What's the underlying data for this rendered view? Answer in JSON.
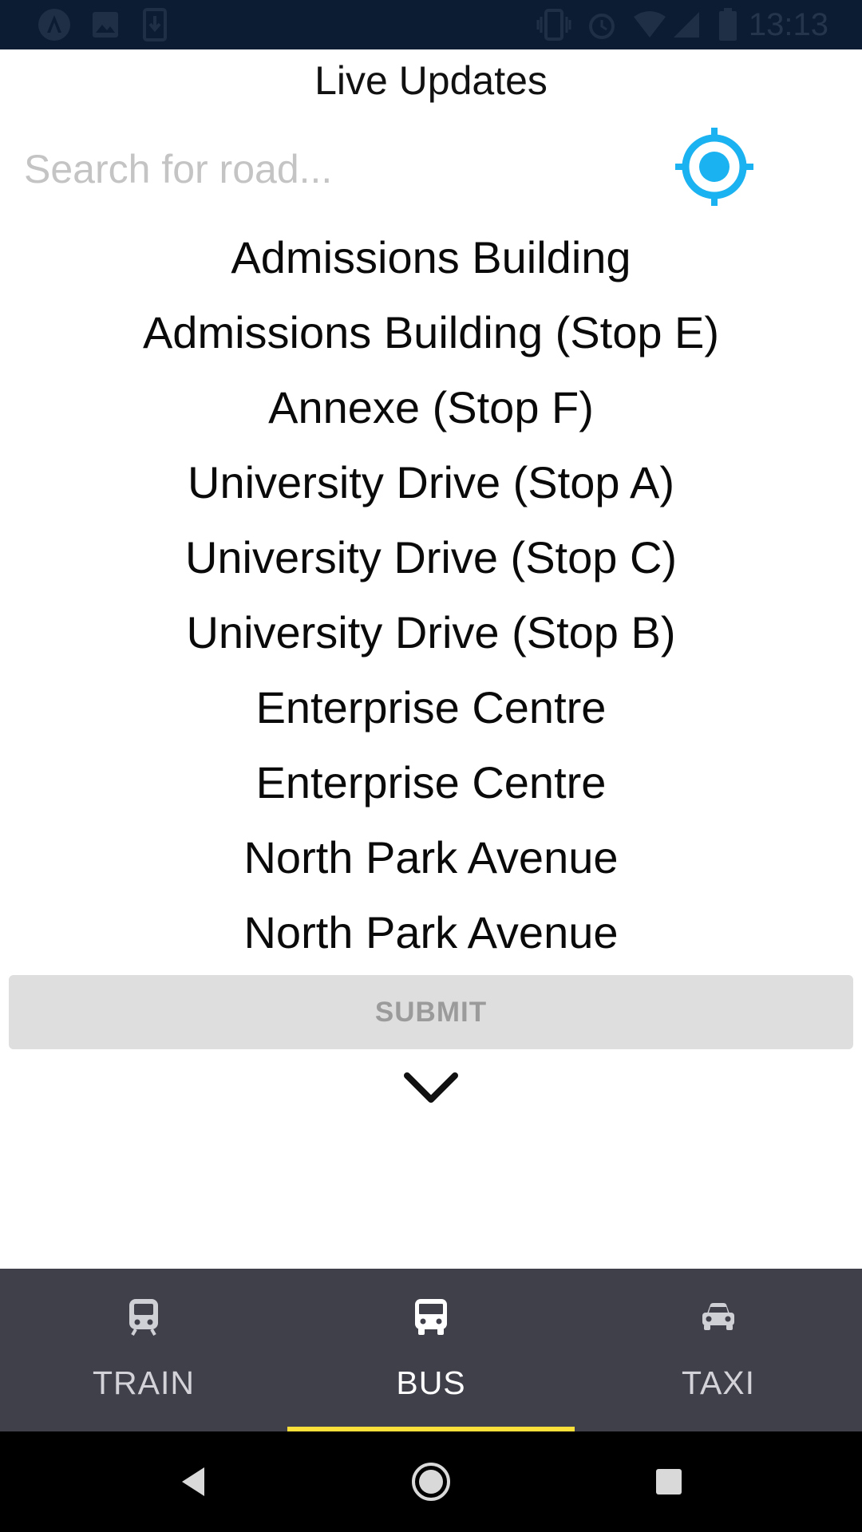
{
  "status_bar": {
    "time": "13:13",
    "icons": [
      "android-circle-icon",
      "image-icon",
      "download-icon",
      "vibrate-icon",
      "alarm-icon",
      "wifi-icon",
      "signal-icon",
      "battery-icon"
    ]
  },
  "header": {
    "title": "Live Updates"
  },
  "search": {
    "placeholder": "Search for road...",
    "value": ""
  },
  "locate_icon": "crosshair-icon",
  "accent_color": "#1ab2f0",
  "stops": [
    {
      "label": "Admissions Building"
    },
    {
      "label": "Admissions Building (Stop E)"
    },
    {
      "label": "Annexe (Stop F)"
    },
    {
      "label": "University Drive (Stop A)"
    },
    {
      "label": "University Drive (Stop C)"
    },
    {
      "label": "University Drive (Stop B)"
    },
    {
      "label": "Enterprise Centre"
    },
    {
      "label": "Enterprise Centre"
    },
    {
      "label": "North Park Avenue"
    },
    {
      "label": "North Park Avenue"
    }
  ],
  "submit": {
    "label": "SUBMIT"
  },
  "tabs": [
    {
      "label": "TRAIN",
      "icon": "train-icon",
      "active": false
    },
    {
      "label": "BUS",
      "icon": "bus-icon",
      "active": true
    },
    {
      "label": "TAXI",
      "icon": "car-icon",
      "active": false
    }
  ],
  "tab_indicator_color": "#fde13a",
  "nav": {
    "icons": [
      "back-icon",
      "home-icon",
      "recents-icon"
    ]
  }
}
